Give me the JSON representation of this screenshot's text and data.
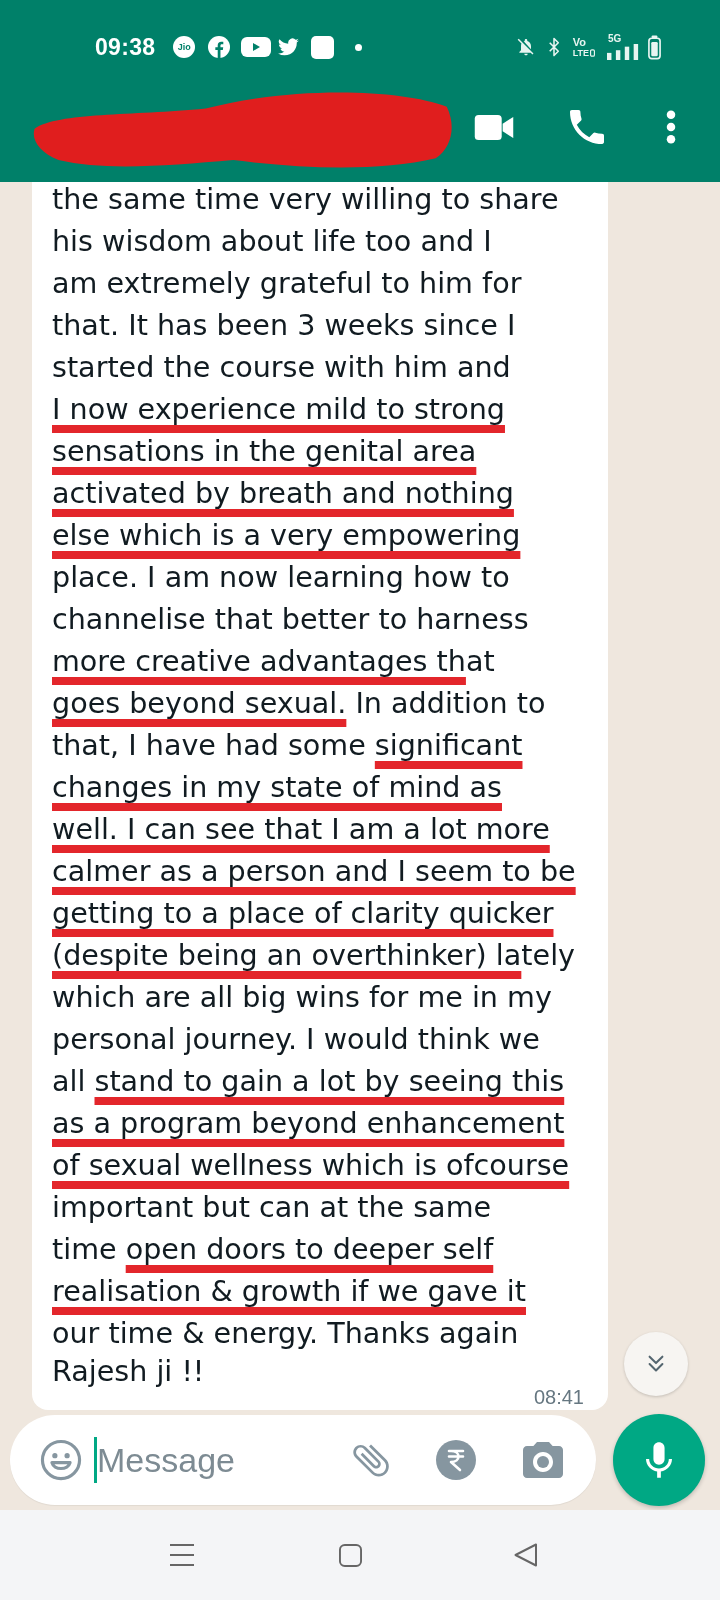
{
  "status_bar": {
    "time": "09:38",
    "carrier_logo": "Jio",
    "volte_top": "Vo",
    "volte_bottom": "LTE",
    "network_type": "5G"
  },
  "header": {
    "name_redacted": true
  },
  "message": {
    "lines": [
      {
        "segments": [
          {
            "text": "the same time very willing to share",
            "underlined": false
          }
        ]
      },
      {
        "segments": [
          {
            "text": "his wisdom about life too and I",
            "underlined": false
          }
        ]
      },
      {
        "segments": [
          {
            "text": "am extremely grateful to him for",
            "underlined": false
          }
        ]
      },
      {
        "segments": [
          {
            "text": "that. It has been 3 weeks since I",
            "underlined": false
          }
        ]
      },
      {
        "segments": [
          {
            "text": "started the course with him and",
            "underlined": false
          }
        ]
      },
      {
        "segments": [
          {
            "text": "I now experience mild to strong",
            "underlined": true
          }
        ]
      },
      {
        "segments": [
          {
            "text": "sensations in the genital area",
            "underlined": true
          }
        ]
      },
      {
        "segments": [
          {
            "text": "activated by breath and nothing",
            "underlined": true
          }
        ]
      },
      {
        "segments": [
          {
            "text": "else which is a very empowering",
            "underlined": true
          }
        ]
      },
      {
        "segments": [
          {
            "text": "place. I am now learning how to",
            "underlined": false
          }
        ]
      },
      {
        "segments": [
          {
            "text": "channelise that better to harness",
            "underlined": false
          }
        ]
      },
      {
        "segments": [
          {
            "text": "more creative advantages th",
            "underlined": true
          },
          {
            "text": "at",
            "underlined": false
          }
        ]
      },
      {
        "segments": [
          {
            "text": "goes beyond sexual.",
            "underlined": true
          },
          {
            "text": " In addition to",
            "underlined": false
          }
        ]
      },
      {
        "segments": [
          {
            "text": "that, I have had some ",
            "underlined": false
          },
          {
            "text": "significant",
            "underlined": true
          }
        ]
      },
      {
        "segments": [
          {
            "text": "changes in my state of mind as",
            "underlined": true
          }
        ]
      },
      {
        "segments": [
          {
            "text": "well. I can see that I am a lot more",
            "underlined": true
          }
        ]
      },
      {
        "segments": [
          {
            "text": "calmer as a person and I seem to be",
            "underlined": true
          }
        ]
      },
      {
        "segments": [
          {
            "text": "getting to a place of clarity quicker",
            "underlined": true
          }
        ]
      },
      {
        "segments": [
          {
            "text": "(despite being an overthinker) la",
            "underlined": true
          },
          {
            "text": "tely",
            "underlined": false
          }
        ]
      },
      {
        "segments": [
          {
            "text": "which are all big wins for me in my",
            "underlined": false
          }
        ]
      },
      {
        "segments": [
          {
            "text": "personal journey. I would think we",
            "underlined": false
          }
        ]
      },
      {
        "segments": [
          {
            "text": "all ",
            "underlined": false
          },
          {
            "text": "stand to gain a lot by seeing this",
            "underlined": true
          }
        ]
      },
      {
        "segments": [
          {
            "text": "as a program beyond enhancement",
            "underlined": true
          }
        ]
      },
      {
        "segments": [
          {
            "text": "of sexual wellness which is ofcourse",
            "underlined": true
          }
        ]
      },
      {
        "segments": [
          {
            "text": "important but can at the same",
            "underlined": false
          }
        ]
      },
      {
        "segments": [
          {
            "text": "time ",
            "underlined": false
          },
          {
            "text": "open doors to deeper self",
            "underlined": true
          }
        ]
      },
      {
        "segments": [
          {
            "text": "realisation & growth if we gave it",
            "underlined": true
          }
        ]
      },
      {
        "segments": [
          {
            "text": "our time & energy. Thanks again",
            "underlined": false
          }
        ]
      },
      {
        "segments": [
          {
            "text": "Rajesh ji !!",
            "underlined": false
          }
        ]
      }
    ],
    "time": "08:41"
  },
  "composer": {
    "placeholder": "Message"
  }
}
